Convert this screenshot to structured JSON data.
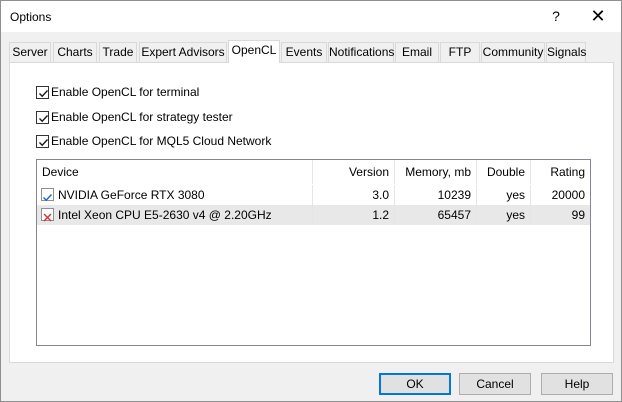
{
  "window": {
    "title": "Options",
    "help_label": "?",
    "close_label": "✕"
  },
  "tabs": [
    {
      "label": "Server"
    },
    {
      "label": "Charts"
    },
    {
      "label": "Trade"
    },
    {
      "label": "Expert Advisors"
    },
    {
      "label": "OpenCL"
    },
    {
      "label": "Events"
    },
    {
      "label": "Notifications"
    },
    {
      "label": "Email"
    },
    {
      "label": "FTP"
    },
    {
      "label": "Community"
    },
    {
      "label": "Signals"
    }
  ],
  "active_tab": "OpenCL",
  "options": [
    {
      "label": "Enable OpenCL for terminal",
      "checked": true
    },
    {
      "label": "Enable OpenCL for strategy tester",
      "checked": true
    },
    {
      "label": "Enable OpenCL for MQL5 Cloud Network",
      "checked": true
    }
  ],
  "devices": {
    "columns": [
      "Device",
      "Version",
      "Memory, mb",
      "Double",
      "Rating"
    ],
    "rows": [
      {
        "device": "NVIDIA GeForce RTX 3080",
        "version": "3.0",
        "memory": "10239",
        "double": "yes",
        "rating": "20000",
        "enabled": true,
        "icon": "check-icon"
      },
      {
        "device": "Intel Xeon CPU E5-2630 v4 @ 2.20GHz",
        "version": "1.2",
        "memory": "65457",
        "double": "yes",
        "rating": "99",
        "enabled": false,
        "icon": "cross-icon"
      }
    ]
  },
  "buttons": {
    "ok": "OK",
    "cancel": "Cancel",
    "help": "Help"
  },
  "colors": {
    "accent": "#0078d7",
    "check_mark": "#1e6bd6",
    "cross_mark": "#d32f2f"
  }
}
